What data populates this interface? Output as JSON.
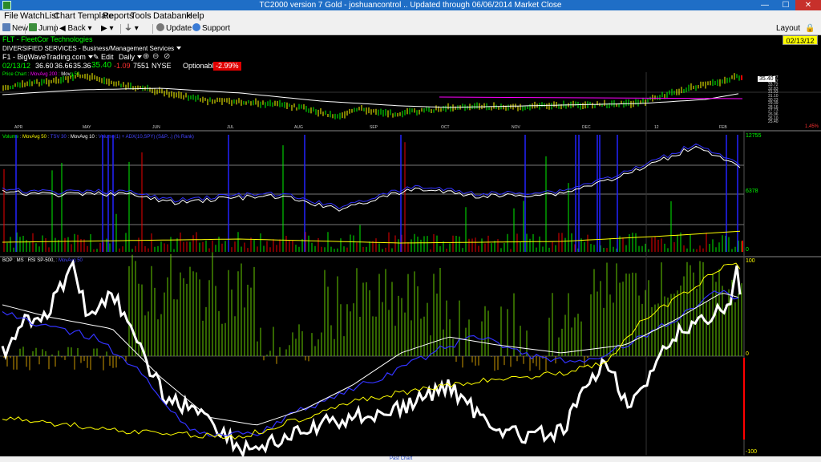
{
  "window": {
    "title": "TC2000 version 7 Gold - joshuancontrol  .. Updated through 06/06/2014  Market Close",
    "min": "—",
    "max": "☐",
    "close": "✕"
  },
  "menu": {
    "items": [
      "File",
      "WatchList",
      "Chart Template",
      "Reports",
      "Tools",
      "Databank",
      "Help"
    ]
  },
  "toolbar": {
    "new": "New",
    "jump": "Jump",
    "back": "Back",
    "forward": "",
    "filter": "",
    "update": "Update",
    "support": "Support",
    "layout": "Layout"
  },
  "header": {
    "symbol": "FLT - FleetCor Technologies",
    "sector": "DIVERSIFIED SERVICES - Business/Management Services",
    "list": "F1 - BigWaveTrading.com",
    "edit": "Edit",
    "period": "Daily",
    "date": "02/13/12",
    "open": "36.60",
    "high": "36.66",
    "low": "35.36",
    "close": "35.40",
    "change": "-1.09",
    "volume": "7551",
    "exchange": "NYSE",
    "optionable": "Optionable",
    "pct": "-2.99%",
    "date_box": "02/13/12"
  },
  "colors": {
    "bg": "#000000",
    "up": "#00ff00",
    "down": "#ff0000",
    "yellow": "#ffff00",
    "blue": "#2222ff",
    "white": "#ffffff",
    "magenta": "#ff00ff",
    "pctbg": "#ff0000"
  },
  "price": {
    "legend": {
      "a": "Price Chart",
      "b": "MovAvg 200",
      "c": "Mov",
      "d": "g 50"
    },
    "last": "35.40",
    "axis": [
      "36.27",
      "35.37",
      "33.72",
      "32.83",
      "31.93",
      "31.10",
      "30.23",
      "29.39",
      "28.16",
      "27.73",
      "26.96",
      "26.10",
      "25.40"
    ],
    "pct_label": "1.45%"
  },
  "volume": {
    "legend": {
      "a": "Volume",
      "b": "MovAvg 50",
      "c": "TSV 30",
      "d": "MovAvg 10",
      "e": "Volume(1) + ADX(10,SPY) (S&P...) (% Rank)"
    },
    "axis": [
      "12755",
      "6378",
      "0"
    ]
  },
  "bop": {
    "legend": {
      "a": "BOP",
      "b": "MS",
      "c": "RSI SP-500,",
      "d": "MovAvg 50"
    },
    "axis": [
      "100",
      "0",
      "-100"
    ]
  },
  "months": [
    "APR",
    "MAY",
    "JUN",
    "JUL",
    "AUG",
    "SEP",
    "OCT",
    "NOV",
    "DEC",
    "12",
    "FEB"
  ],
  "status": {
    "label": "Past Chart"
  }
}
